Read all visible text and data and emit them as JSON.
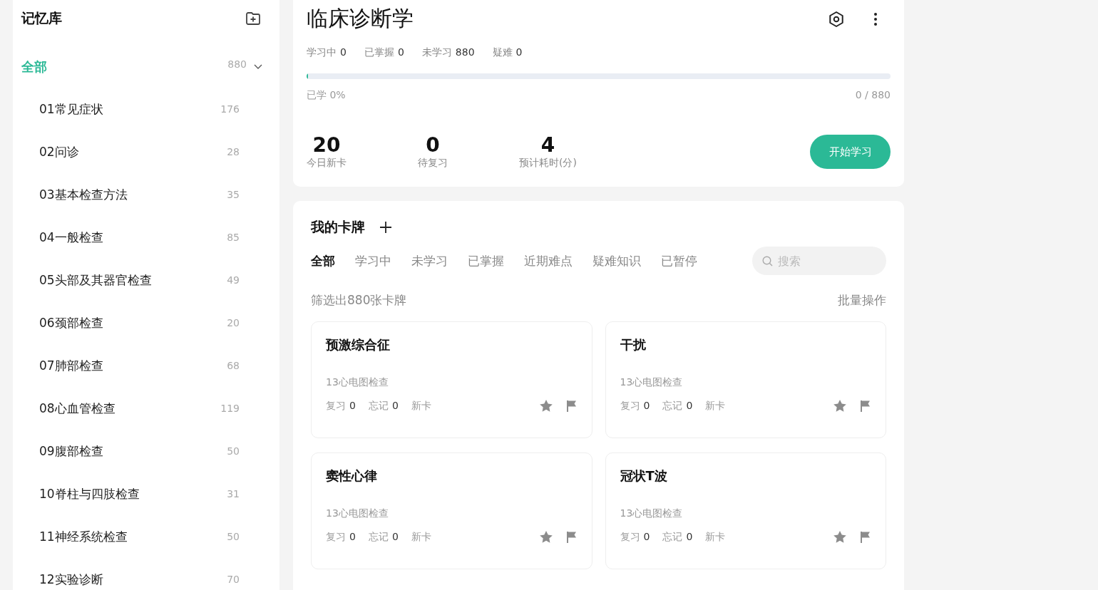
{
  "sidebar": {
    "title": "记忆库",
    "all": {
      "label": "全部",
      "count": "880",
      "selected": true,
      "expanded": true
    },
    "items": [
      {
        "label": "01常见症状",
        "count": "176",
        "selected": false
      },
      {
        "label": "02问诊",
        "count": "28",
        "selected": false
      },
      {
        "label": "03基本检查方法",
        "count": "35",
        "selected": false
      },
      {
        "label": "04一般检查",
        "count": "85",
        "selected": false
      },
      {
        "label": "05头部及其器官检查",
        "count": "49",
        "selected": false
      },
      {
        "label": "06颈部检查",
        "count": "20",
        "selected": false
      },
      {
        "label": "07肺部检查",
        "count": "68",
        "selected": false
      },
      {
        "label": "08心血管检查",
        "count": "119",
        "selected": false
      },
      {
        "label": "09腹部检查",
        "count": "50",
        "selected": false
      },
      {
        "label": "10脊柱与四肢检查",
        "count": "31",
        "selected": false
      },
      {
        "label": "11神经系统检查",
        "count": "50",
        "selected": false
      },
      {
        "label": "12实验诊断",
        "count": "70",
        "selected": false
      }
    ]
  },
  "deck": {
    "title": "临床诊断学",
    "stats": [
      {
        "label": "学习中",
        "value": "0"
      },
      {
        "label": "已掌握",
        "value": "0"
      },
      {
        "label": "未学习",
        "value": "880"
      },
      {
        "label": "疑难",
        "value": "0"
      }
    ],
    "progress": {
      "level": 0,
      "label": "已学 0%",
      "reading": "0 / 880"
    },
    "summary": [
      {
        "value": "20",
        "label": "今日新卡"
      },
      {
        "value": "0",
        "label": "待复习"
      },
      {
        "value": "4",
        "label": "预计耗时(分)"
      }
    ],
    "start_button": "开始学习"
  },
  "cards_panel": {
    "title": "我的卡牌",
    "tabs": [
      {
        "label": "全部",
        "selected": true
      },
      {
        "label": "学习中",
        "selected": false
      },
      {
        "label": "未学习",
        "selected": false
      },
      {
        "label": "已掌握",
        "selected": false
      },
      {
        "label": "近期难点",
        "selected": false
      },
      {
        "label": "疑难知识",
        "selected": false
      },
      {
        "label": "已暂停",
        "selected": false
      }
    ],
    "search": {
      "placeholder": "搜索"
    },
    "filter_text": "筛选出880张卡牌",
    "batch_action": "批量操作",
    "cards": [
      {
        "title": "预激综合征",
        "deck": "13心电图检查",
        "review_label": "复习",
        "review": "0",
        "forget_label": "忘记",
        "forget": "0",
        "status": "新卡"
      },
      {
        "title": "干扰",
        "deck": "13心电图检查",
        "review_label": "复习",
        "review": "0",
        "forget_label": "忘记",
        "forget": "0",
        "status": "新卡"
      },
      {
        "title": "窦性心律",
        "deck": "13心电图检查",
        "review_label": "复习",
        "review": "0",
        "forget_label": "忘记",
        "forget": "0",
        "status": "新卡"
      },
      {
        "title": "冠状T波",
        "deck": "13心电图检查",
        "review_label": "复习",
        "review": "0",
        "forget_label": "忘记",
        "forget": "0",
        "status": "新卡"
      }
    ]
  }
}
